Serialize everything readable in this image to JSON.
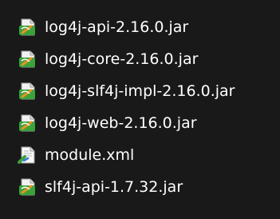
{
  "file_list": {
    "items": [
      {
        "name": "log4j-api-2.16.0.jar",
        "icon": "jar-file-icon"
      },
      {
        "name": "log4j-core-2.16.0.jar",
        "icon": "jar-file-icon"
      },
      {
        "name": "log4j-slf4j-impl-2.16.0.jar",
        "icon": "jar-file-icon"
      },
      {
        "name": "log4j-web-2.16.0.jar",
        "icon": "jar-file-icon"
      },
      {
        "name": "module.xml",
        "icon": "xml-file-icon"
      },
      {
        "name": "slf4j-api-1.7.32.jar",
        "icon": "jar-file-icon"
      }
    ]
  },
  "colors": {
    "background": "#191919",
    "text": "#ffffff",
    "jar_green": "#3aa33a",
    "jar_orange": "#e8922a",
    "page_white": "#f2f2f2"
  }
}
